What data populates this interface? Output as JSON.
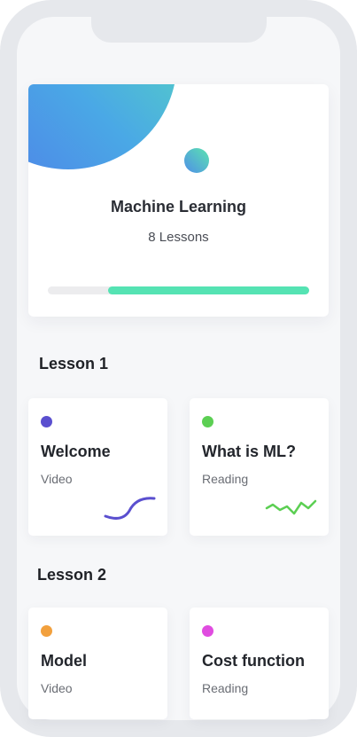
{
  "course": {
    "title": "Machine Learning",
    "lesson_count": "8 Lessons",
    "progress": 0.77
  },
  "sections": [
    {
      "heading": "Lesson 1",
      "cards": [
        {
          "title": "Welcome",
          "type": "Video",
          "dot_color": "#5a4fcf",
          "line_color": "#5a4fcf"
        },
        {
          "title": "What is ML?",
          "type": "Reading",
          "dot_color": "#5ccf53",
          "line_color": "#5ccf53"
        }
      ]
    },
    {
      "heading": "Lesson 2",
      "cards": [
        {
          "title": "Model",
          "type": "Video",
          "dot_color": "#f2a03d"
        },
        {
          "title": "Cost function",
          "type": "Reading",
          "dot_color": "#e04ce0"
        }
      ]
    }
  ],
  "colors": {
    "accent": "#55e3b3",
    "background": "#f6f7f9"
  }
}
